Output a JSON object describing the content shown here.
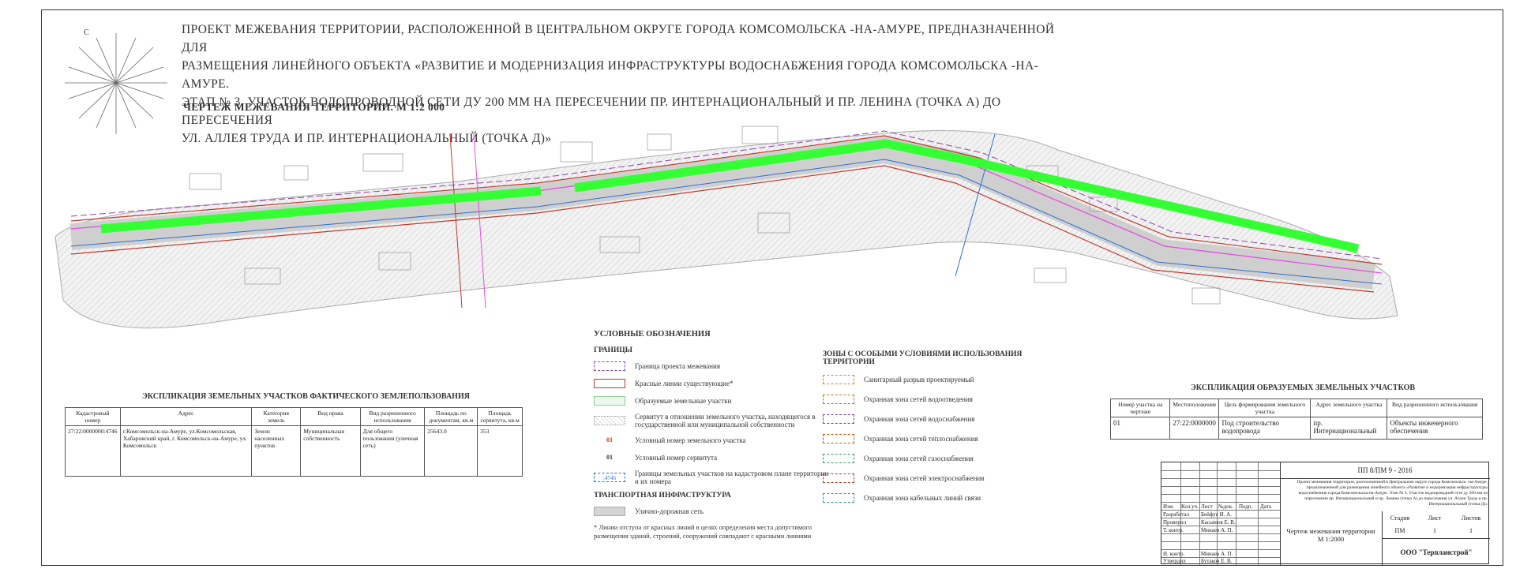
{
  "compass": {
    "label": "С"
  },
  "title": {
    "line1": "ПРОЕКТ МЕЖЕВАНИЯ ТЕРРИТОРИИ, РАСПОЛОЖЕННОЙ В ЦЕНТРАЛЬНОМ ОКРУГЕ ГОРОДА КОМСОМОЛЬСКА -НА-АМУРЕ, ПРЕДНАЗНАЧЕННОЙ ДЛЯ",
    "line2": "РАЗМЕЩЕНИЯ ЛИНЕЙНОГО ОБЪЕКТА «РАЗВИТИЕ И МОДЕРНИЗАЦИЯ ИНФРАСТРУКТУРЫ ВОДОСНАБЖЕНИЯ ГОРОДА КОМСОМОЛЬСКА -НА-АМУРЕ.",
    "line3": "ЭТАП № 3. УЧАСТОК ВОДОПРОВОДНОЙ СЕТИ ДУ 200 ММ НА ПЕРЕСЕЧЕНИИ ПР. ИНТЕРНАЦИОНАЛЬНЫЙ И ПР. ЛЕНИНА (ТОЧКА А) ДО ПЕРЕСЕЧЕНИЯ",
    "line4": "УЛ. АЛЛЕЯ ТРУДА И ПР. ИНТЕРНАЦИОНАЛЬНЫЙ (ТОЧКА Д)»",
    "subtitle": "ЧЕРТЕЖ МЕЖЕВАНИЯ ТЕРРИТОРИИ. М 1:2 000"
  },
  "colors": {
    "route": "#33ff33",
    "red_line": "#c0392b",
    "purple": "#8e44ad",
    "magenta": "#e74ce0",
    "blue": "#2c6fd6"
  },
  "table1": {
    "caption": "ЭКСПЛИКАЦИЯ ЗЕМЕЛЬНЫХ УЧАСТКОВ ФАКТИЧЕСКОГО ЗЕМЛЕПОЛЬЗОВАНИЯ",
    "headers": [
      "Кадастровый номер",
      "Адрес",
      "Категория земель",
      "Вид права",
      "Вид разрешенного использования",
      "Площадь по документам, кв.м",
      "Площадь сервитута, кв.м"
    ],
    "row": [
      "27:22:0000000:4746",
      "г.Комсомольск-на-Амуре, ул.Комсомольская, Хабаровский край, г. Комсомольск-на-Амуре, ул. Комсомольск",
      "Земли населенных пунктов",
      "Муниципальная собственность",
      "Для общего пользования (уличная сеть)",
      "25643.0",
      "353"
    ]
  },
  "legend": {
    "heading": "УСЛОВНЫЕ ОБОЗНАЧЕНИЯ",
    "borders_heading": "ГРАНИЦЫ",
    "items": [
      "Граница проекта межевания",
      "Красные линии существующие*",
      "Образуемые земельные участки",
      "Сервитут в отношении земельного участка, находящегося в государственной или муниципальной собственности",
      "Условный номер земельного участка",
      "Условный номер сервитута",
      "Границы земельных участков на кадастровом плане территории и их номера"
    ],
    "num_parcel": "01",
    "num_servitude": "01",
    "num_cadastre": ":4746",
    "transport_heading": "ТРАНСПОРТНАЯ ИНФРАСТРУКТУРА",
    "transport_item": "Улично-дорожная сеть",
    "note": "* Линии отступа от красных линий в целях определения места допустимого размещения зданий, строений, сооружений совпадают с красными линиями"
  },
  "zones": {
    "heading": "ЗОНЫ С ОСОБЫМИ УСЛОВИЯМИ ИСПОЛЬЗОВАНИЯ ТЕРРИТОРИИ",
    "items": [
      "Санитарный разрыв проектируемый",
      "Охранная зона сетей водоотведения",
      "Охранная зона сетей водоснабжения",
      "Охранная зона сетей теплоснабжения",
      "Охранная зона сетей газоснабжения",
      "Охранная зона сетей электроснабжения",
      "Охранная зона кабельных линий связи"
    ],
    "colors": [
      "#e67e22",
      "#b9770e",
      "#7d3c98",
      "#d35400",
      "#27ae60",
      "#c0392b",
      "#17a589"
    ]
  },
  "table2": {
    "caption": "ЭКСПЛИКАЦИЯ ОБРАЗУЕМЫХ ЗЕМЕЛЬНЫХ УЧАСТКОВ",
    "headers": [
      "Номер участка на чертеже",
      "Местоположение",
      "Цель формирования земельного участка",
      "Адрес земельного участка",
      "Вид разрешенного использования"
    ],
    "row": [
      "01",
      "27:22:0000000",
      "Под строительство водопровода",
      "пр. Интернациональный",
      "Объекты инженерного обеспечения"
    ]
  },
  "stamp": {
    "code": "ПП 8/ПМ 9 - 2016",
    "description": "Проект межевания территории, расположенной в Центральном округе города Комсомольск -на-Амуре, предназначенной для размещения линейного объекта «Развитие и модернизация инфраструктуры водоснабжения города Комсомольска-на-Амуре. Этап № 3. Участок водопроводной сети ду 200 мм на пересечении пр. Интернациональный и пр. Ленина (точка А) до пересечения ул. Аллея Труда и пр. Интернациональный (точка Д)»",
    "col_heads": [
      "Изм.",
      "Кол.уч.",
      "Лист",
      "№док.",
      "Подп.",
      "Дата"
    ],
    "roles": [
      {
        "role": "Разработал",
        "name": "Бейфус И. А."
      },
      {
        "role": "Проверил",
        "name": "Касьянов Е. В."
      },
      {
        "role": "Т. контр.",
        "name": "Минаев А. П."
      },
      {
        "role": "Н. контр.",
        "name": "Минаев А. П."
      },
      {
        "role": "Утвердил",
        "name": "Бутаков Е. В."
      }
    ],
    "sheet_title": "Чертеж межевания территории",
    "sheet_scale": "М 1:2000",
    "meta_heads": [
      "Стадия",
      "Лист",
      "Листов"
    ],
    "meta_vals": [
      "ПМ",
      "1",
      "1"
    ],
    "company": "ООО \"Терпланстрой\""
  }
}
